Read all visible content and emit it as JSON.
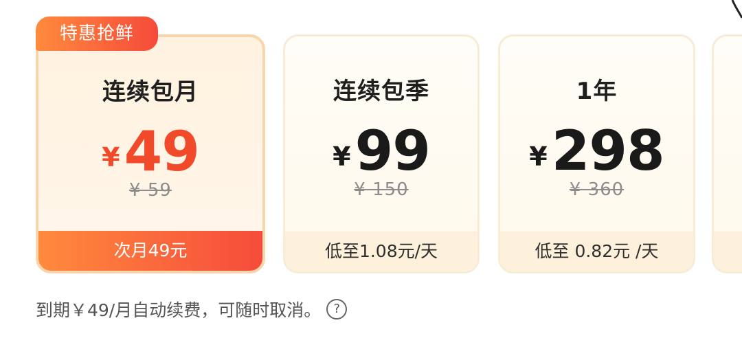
{
  "badge": {
    "label": "特惠抢鲜"
  },
  "plans": [
    {
      "title": "连续包月",
      "currency": "¥",
      "price": "49",
      "original": "¥ 59",
      "note": "次月49元",
      "selected": true
    },
    {
      "title": "连续包季",
      "currency": "¥",
      "price": "99",
      "original": "¥ 150",
      "note": "低至1.08元/天",
      "selected": false
    },
    {
      "title": "1年",
      "currency": "¥",
      "price": "298",
      "original": "¥ 360",
      "note": "低至 0.82元 /天",
      "selected": false
    }
  ],
  "footer": {
    "note": "到期￥49/月自动续费，可随时取消。",
    "help_icon": "help-circle-icon"
  },
  "colors": {
    "accent_start": "#ff8a3d",
    "accent_end": "#f54b3a",
    "price_selected": "#f04a2a"
  }
}
